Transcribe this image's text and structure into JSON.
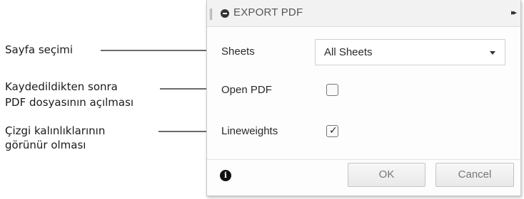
{
  "annotations": {
    "sheets_note": "Sayfa seçimi",
    "open_pdf_note_line1": "Kaydedildikten sonra",
    "open_pdf_note_line2": "PDF dosyasının açılması",
    "lineweights_note_line1": "Çizgi kalınlıklarının",
    "lineweights_note_line2": "görünür olması"
  },
  "dialog": {
    "title": "EXPORT PDF",
    "title_icon": "minus-circle-icon",
    "expand_icon": "double-chevron-right-icon",
    "expand_glyph": "▸▸",
    "sheets": {
      "label": "Sheets",
      "value": "All Sheets"
    },
    "open_pdf": {
      "label": "Open PDF",
      "checked": false
    },
    "lineweights": {
      "label": "Lineweights",
      "checked": true,
      "mark": "✓"
    },
    "info_glyph": "i",
    "ok_label": "OK",
    "cancel_label": "Cancel"
  },
  "colors": {
    "arrow": "#3aa3a3",
    "leader_line": "#6b6b6b"
  }
}
